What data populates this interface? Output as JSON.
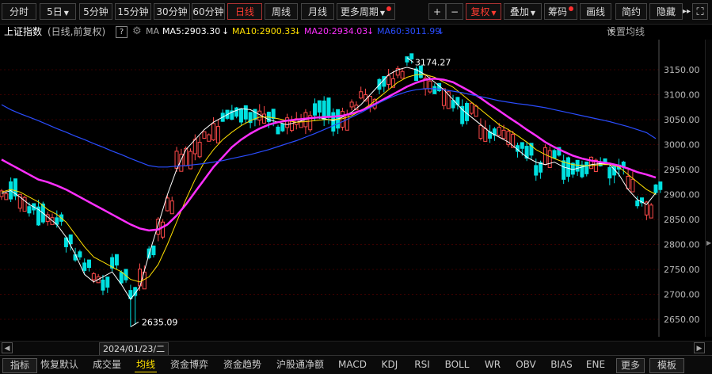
{
  "toolbar": {
    "periods": [
      "分时",
      "5日",
      "5分钟",
      "15分钟",
      "30分钟",
      "60分钟",
      "日线",
      "周线",
      "月线",
      "更多周期"
    ],
    "active_period": "日线",
    "right_buttons": [
      "+",
      "−",
      "复权",
      "叠加",
      "筹码",
      "画线",
      "简约",
      "隐藏"
    ],
    "expand_icon": "⛶",
    "more_arrows": "▸▸"
  },
  "info": {
    "index_name": "上证指数",
    "mode": "(日线,前复权)",
    "help": "?",
    "ma_label": "MA",
    "ma5": "MA5:2903.30",
    "ma10": "MA10:2900.33",
    "ma20": "MA20:2934.03",
    "ma60": "MA60:3011.99",
    "settings": "设置均线"
  },
  "colors": {
    "up": "#ff4a4a",
    "down": "#00e0e0",
    "ma5": "#ffffff",
    "ma10": "#ffe000",
    "ma20": "#ff2fff",
    "ma60": "#2a4dff",
    "grid": "#3a0000"
  },
  "chart_data": {
    "type": "candlestick",
    "title": "上证指数",
    "ylim": [
      2610,
      3200
    ],
    "yticks": [
      "3150.00",
      "3100.00",
      "3050.00",
      "3000.00",
      "2950.00",
      "2900.00",
      "2850.00",
      "2800.00",
      "2750.00",
      "2700.00",
      "2650.00"
    ],
    "high_label": "3174.27",
    "low_label": "2635.09",
    "high_value": 3174.27,
    "low_value": 2635.09,
    "cursor_date": "2024/01/23/二",
    "series": [
      {
        "name": "MA5",
        "values": [
          2902,
          2908,
          2895,
          2880,
          2870,
          2855,
          2840,
          2815,
          2780,
          2740,
          2725,
          2735,
          2745,
          2720,
          2690,
          2715,
          2780,
          2840,
          2900,
          2950,
          2990,
          3010,
          3030,
          3045,
          3055,
          3065,
          3072,
          3070,
          3060,
          3050,
          3045,
          3040,
          3045,
          3050,
          3055,
          3052,
          3048,
          3055,
          3065,
          3080,
          3100,
          3120,
          3140,
          3150,
          3155,
          3150,
          3140,
          3125,
          3110,
          3090,
          3070,
          3055,
          3040,
          3025,
          3015,
          3005,
          2990,
          2975,
          2965,
          2960,
          2965,
          2955,
          2950,
          2955,
          2960,
          2962,
          2960,
          2940,
          2910,
          2890,
          2880,
          2903.3
        ]
      },
      {
        "name": "MA10",
        "values": [
          2905,
          2910,
          2905,
          2895,
          2885,
          2870,
          2860,
          2845,
          2820,
          2795,
          2775,
          2765,
          2755,
          2745,
          2730,
          2725,
          2735,
          2760,
          2800,
          2845,
          2890,
          2930,
          2965,
          2990,
          3010,
          3025,
          3038,
          3048,
          3055,
          3055,
          3052,
          3048,
          3045,
          3046,
          3048,
          3050,
          3050,
          3052,
          3058,
          3068,
          3080,
          3095,
          3110,
          3125,
          3135,
          3140,
          3140,
          3135,
          3125,
          3115,
          3100,
          3085,
          3070,
          3055,
          3040,
          3030,
          3018,
          3005,
          2990,
          2980,
          2972,
          2965,
          2960,
          2958,
          2958,
          2960,
          2960,
          2955,
          2940,
          2925,
          2910,
          2900.33
        ]
      },
      {
        "name": "MA20",
        "values": [
          2970,
          2960,
          2950,
          2940,
          2930,
          2925,
          2918,
          2910,
          2900,
          2890,
          2880,
          2870,
          2860,
          2850,
          2840,
          2832,
          2828,
          2830,
          2840,
          2858,
          2880,
          2905,
          2930,
          2955,
          2975,
          2995,
          3010,
          3022,
          3032,
          3040,
          3045,
          3048,
          3050,
          3052,
          3054,
          3055,
          3056,
          3058,
          3062,
          3068,
          3076,
          3086,
          3096,
          3106,
          3116,
          3124,
          3130,
          3132,
          3130,
          3125,
          3115,
          3105,
          3093,
          3080,
          3068,
          3055,
          3043,
          3030,
          3018,
          3005,
          2995,
          2986,
          2978,
          2972,
          2968,
          2965,
          2962,
          2958,
          2952,
          2945,
          2940,
          2934.03
        ]
      },
      {
        "name": "MA60",
        "values": [
          3080,
          3070,
          3062,
          3055,
          3048,
          3040,
          3032,
          3025,
          3017,
          3010,
          3002,
          2995,
          2987,
          2980,
          2972,
          2965,
          2958,
          2955,
          2955,
          2957,
          2958,
          2960,
          2962,
          2965,
          2968,
          2972,
          2976,
          2980,
          2985,
          2990,
          2996,
          3002,
          3008,
          3015,
          3022,
          3030,
          3038,
          3046,
          3055,
          3064,
          3074,
          3084,
          3093,
          3100,
          3106,
          3110,
          3112,
          3112,
          3110,
          3107,
          3104,
          3100,
          3096,
          3092,
          3088,
          3085,
          3082,
          3080,
          3077,
          3074,
          3070,
          3066,
          3062,
          3058,
          3054,
          3050,
          3046,
          3041,
          3036,
          3030,
          3024,
          3011.99
        ]
      }
    ]
  },
  "bottom": {
    "tabs": [
      "指标",
      "恢复默认",
      "成交量",
      "均线",
      "资金博弈",
      "资金趋势",
      "沪股通净额",
      "MACD",
      "KDJ",
      "RSI",
      "BOLL",
      "WR",
      "OBV",
      "BIAS",
      "ENE",
      "更多",
      "模板"
    ],
    "active": "均线"
  }
}
